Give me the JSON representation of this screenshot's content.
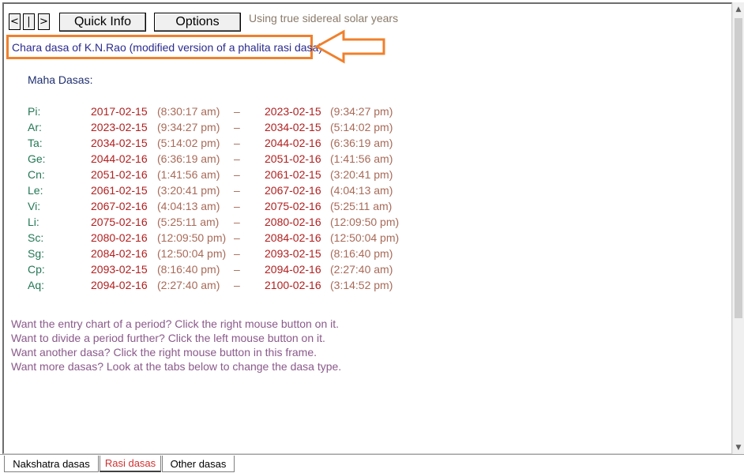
{
  "toolbar": {
    "prev_label": "<",
    "mid_label": "|",
    "next_label": ">",
    "quick_info_label": "Quick Info",
    "options_label": "Options",
    "status": "Using true sidereal solar years"
  },
  "title": "Chara dasa of K.N.Rao (modified version of a phalita rasi dasa):",
  "subheading": "Maha Dasas:",
  "dasas": [
    {
      "sign": "Pi:",
      "start_date": "2017-02-15",
      "start_time": "(8:30:17 am)",
      "dash": "–",
      "end_date": "2023-02-15",
      "end_time": "(9:34:27 pm)"
    },
    {
      "sign": "Ar:",
      "start_date": "2023-02-15",
      "start_time": "(9:34:27 pm)",
      "dash": "–",
      "end_date": "2034-02-15",
      "end_time": "(5:14:02 pm)"
    },
    {
      "sign": "Ta:",
      "start_date": "2034-02-15",
      "start_time": "(5:14:02 pm)",
      "dash": "–",
      "end_date": "2044-02-16",
      "end_time": "(6:36:19 am)"
    },
    {
      "sign": "Ge:",
      "start_date": "2044-02-16",
      "start_time": "(6:36:19 am)",
      "dash": "–",
      "end_date": "2051-02-16",
      "end_time": "(1:41:56 am)"
    },
    {
      "sign": "Cn:",
      "start_date": "2051-02-16",
      "start_time": "(1:41:56 am)",
      "dash": "–",
      "end_date": "2061-02-15",
      "end_time": "(3:20:41 pm)"
    },
    {
      "sign": "Le:",
      "start_date": "2061-02-15",
      "start_time": "(3:20:41 pm)",
      "dash": "–",
      "end_date": "2067-02-16",
      "end_time": "(4:04:13 am)"
    },
    {
      "sign": "Vi:",
      "start_date": "2067-02-16",
      "start_time": "(4:04:13 am)",
      "dash": "–",
      "end_date": "2075-02-16",
      "end_time": "(5:25:11 am)"
    },
    {
      "sign": "Li:",
      "start_date": "2075-02-16",
      "start_time": "(5:25:11 am)",
      "dash": "–",
      "end_date": "2080-02-16",
      "end_time": "(12:09:50 pm)"
    },
    {
      "sign": "Sc:",
      "start_date": "2080-02-16",
      "start_time": "(12:09:50 pm)",
      "dash": "–",
      "end_date": "2084-02-16",
      "end_time": "(12:50:04 pm)"
    },
    {
      "sign": "Sg:",
      "start_date": "2084-02-16",
      "start_time": "(12:50:04 pm)",
      "dash": "–",
      "end_date": "2093-02-15",
      "end_time": "(8:16:40 pm)"
    },
    {
      "sign": "Cp:",
      "start_date": "2093-02-15",
      "start_time": "(8:16:40 pm)",
      "dash": "–",
      "end_date": "2094-02-16",
      "end_time": "(2:27:40 am)"
    },
    {
      "sign": "Aq:",
      "start_date": "2094-02-16",
      "start_time": "(2:27:40 am)",
      "dash": "–",
      "end_date": "2100-02-16",
      "end_time": "(3:14:52 pm)"
    }
  ],
  "hints": [
    "Want the entry chart of a period? Click the right mouse button on it.",
    "Want to divide a period further? Click the left mouse button on it.",
    "Want another dasa? Click the right mouse button in this frame.",
    "Want more dasas? Look at the tabs below to change the dasa type."
  ],
  "tabs": [
    {
      "label": "Nakshatra dasas"
    },
    {
      "label": "Rasi dasas",
      "active": true
    },
    {
      "label": "Other dasas"
    }
  ],
  "colors": {
    "highlight": "#f0802c",
    "sign": "#227755",
    "date": "#b22020",
    "time": "#a86a58",
    "hint": "#8a5a8a"
  }
}
